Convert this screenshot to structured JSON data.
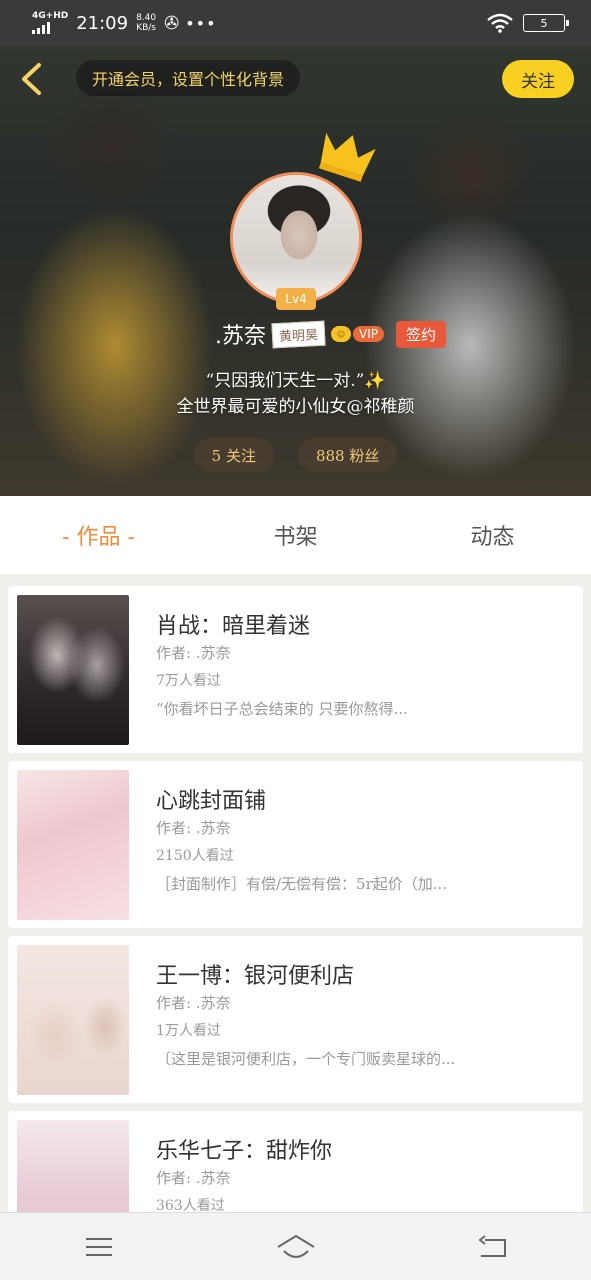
{
  "status_bar": {
    "network": "4G+HD",
    "time": "21:09",
    "speed_value": "8.40",
    "speed_unit": "KB/s",
    "more": "•••",
    "battery": "5"
  },
  "header": {
    "vip_prompt": "开通会员，设置个性化背景",
    "follow_label": "关注"
  },
  "profile": {
    "level": "Lv4",
    "username": ".苏奈",
    "name_tag": "黄明昊",
    "vip_label": "VIP",
    "signed_label": "签约",
    "quote_line1": "“只因我们天生一对.”",
    "quote_line2": "全世界最可爱的小仙女@祁稚颜",
    "following": "5 关注",
    "followers": "888 粉丝"
  },
  "tabs": [
    {
      "label": "- 作品 -",
      "active": true
    },
    {
      "label": "书架",
      "active": false
    },
    {
      "label": "动态",
      "active": false
    }
  ],
  "works": [
    {
      "title": "肖战：暗里着迷",
      "author": "作者: .苏奈",
      "views": "7万人看过",
      "desc": "“你看坏日子总会结束的 只要你熬得..."
    },
    {
      "title": "心跳封面铺",
      "author": "作者: .苏奈",
      "views": "2150人看过",
      "desc": "［封面制作］有偿/无偿有偿：5r起价（加..."
    },
    {
      "title": "王一博：银河便利店",
      "author": "作者: .苏奈",
      "views": "1万人看过",
      "desc": "〔这里是银河便利店，一个专门贩卖星球的..."
    },
    {
      "title": "乐华七子：甜炸你",
      "author": "作者: .苏奈",
      "views": "363人看过",
      "desc": ""
    }
  ],
  "colors": {
    "accent": "#f08c3a",
    "follow_button": "#f7d022",
    "signed_badge": "#e8583a",
    "level_badge": "#f2b046"
  }
}
